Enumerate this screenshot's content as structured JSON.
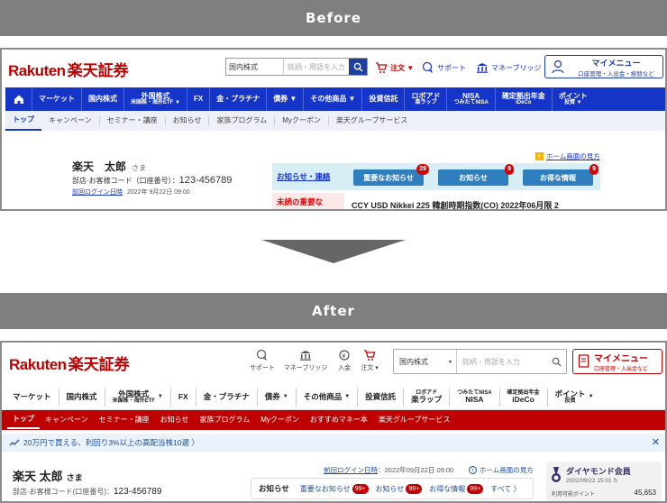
{
  "banners": {
    "before": "Before",
    "after": "After"
  },
  "before": {
    "logo_latin": "Rakuten",
    "logo_jp": "楽天証券",
    "search": {
      "category": "国内株式",
      "placeholder": "銘柄・用語を入力"
    },
    "top_links": {
      "order": "注文 ▼",
      "support": "サポート",
      "money_bridge": "マネーブリッジ"
    },
    "mymenu": {
      "title": "マイメニュー",
      "sub": "口座管理・入出金・振替など"
    },
    "nav": [
      {
        "label": "マーケット"
      },
      {
        "label": "国内株式"
      },
      {
        "label": "外国株式",
        "sub": "米国株・海外ETF ▼"
      },
      {
        "label": "FX"
      },
      {
        "label": "金・プラチナ"
      },
      {
        "label": "債券 ▼"
      },
      {
        "label": "その他商品 ▼"
      },
      {
        "label": "投資信託"
      },
      {
        "label": "ロボアド",
        "sub": "楽ラップ"
      },
      {
        "label": "NISA",
        "sub": "つみたてNISA"
      },
      {
        "label": "確定拠出年金",
        "sub": "iDeCo"
      },
      {
        "label": "ポイント",
        "sub": "投資 ▼"
      }
    ],
    "subnav": [
      "トップ",
      "キャンペーン",
      "セミナー・講座",
      "お知らせ",
      "家族プログラム",
      "Myクーポン",
      "楽天グループサービス"
    ],
    "guide": "ホーム画面の見方",
    "user": {
      "name": "楽天　太郎",
      "sama": "さま",
      "acct_label": "部店-お客様コード（口座番号）：",
      "acct_num": "123-456789",
      "login_label": "前回ログイン日時",
      "login_value": "2022年 9月22日 09:00"
    },
    "notice": {
      "title": "お知らせ・連絡",
      "buttons": [
        {
          "label": "重要なお知らせ",
          "count": "29"
        },
        {
          "label": "お知らせ",
          "count": "9"
        },
        {
          "label": "お得な情報",
          "count": "9"
        }
      ],
      "unread": "未読の重要な",
      "ticker": "CCY USD Nikkei 225 韓創時期指数(CO) 2022年06月限 2"
    }
  },
  "after": {
    "logo_latin": "Rakuten",
    "logo_jp": "楽天証券",
    "icons": {
      "support": "サポート",
      "money_bridge": "マネーブリッジ",
      "deposit": "入金",
      "order": "注文 ▾"
    },
    "search": {
      "category": "国内株式",
      "placeholder": "銘柄・用語を入力"
    },
    "mymenu": {
      "title": "マイメニュー",
      "sub": "口座管理・入出金など"
    },
    "nav": [
      {
        "label": "マーケット"
      },
      {
        "label": "国内株式"
      },
      {
        "label": "外国株式",
        "sub": "米国株・海外ETF"
      },
      {
        "label": "FX"
      },
      {
        "label": "金・プラチナ"
      },
      {
        "label": "債券"
      },
      {
        "label": "その他商品"
      },
      {
        "label": "投資信託"
      },
      {
        "label": "ロボアド",
        "sub": "楽ラップ"
      },
      {
        "label": "つみたてNISA",
        "sub": "NISA"
      },
      {
        "label": "確定拠出年金",
        "sub": "iDeCo"
      },
      {
        "label": "ポイント",
        "sub": "投資"
      }
    ],
    "subnav": [
      "トップ",
      "キャンペーン",
      "セミナー・講座",
      "お知らせ",
      "家族プログラム",
      "Myクーポン",
      "おすすめマネー本",
      "楽天グループサービス"
    ],
    "promo": "20万円で買える、利回り3%以上の高配当株10選 〉",
    "user": {
      "name": "楽天 太郎",
      "sama": "さま",
      "acct_label": "部店-お客様コード(口座番号)：",
      "acct_num": "123-456789"
    },
    "login": {
      "label": "前回ログイン日時",
      "value": "：2022年09月22日 09:00"
    },
    "guide": "ホーム画面の見方",
    "notice": {
      "title": "お知らせ",
      "links": [
        {
          "label": "重要なお知らせ",
          "count": "99+"
        },
        {
          "label": "お知らせ",
          "count": "99+"
        },
        {
          "label": "お得な情報",
          "count": "99+"
        }
      ],
      "all": "すべて 〉"
    },
    "member": {
      "rank": "ダイヤモンド会員",
      "date": "2022/09/22 15:01",
      "points_label": "利用可能ポイント",
      "points": "45,653"
    }
  },
  "colors": {
    "before_nav": "#1534c8",
    "after_subnav": "#bf0000",
    "brand_red": "#bf0000"
  }
}
